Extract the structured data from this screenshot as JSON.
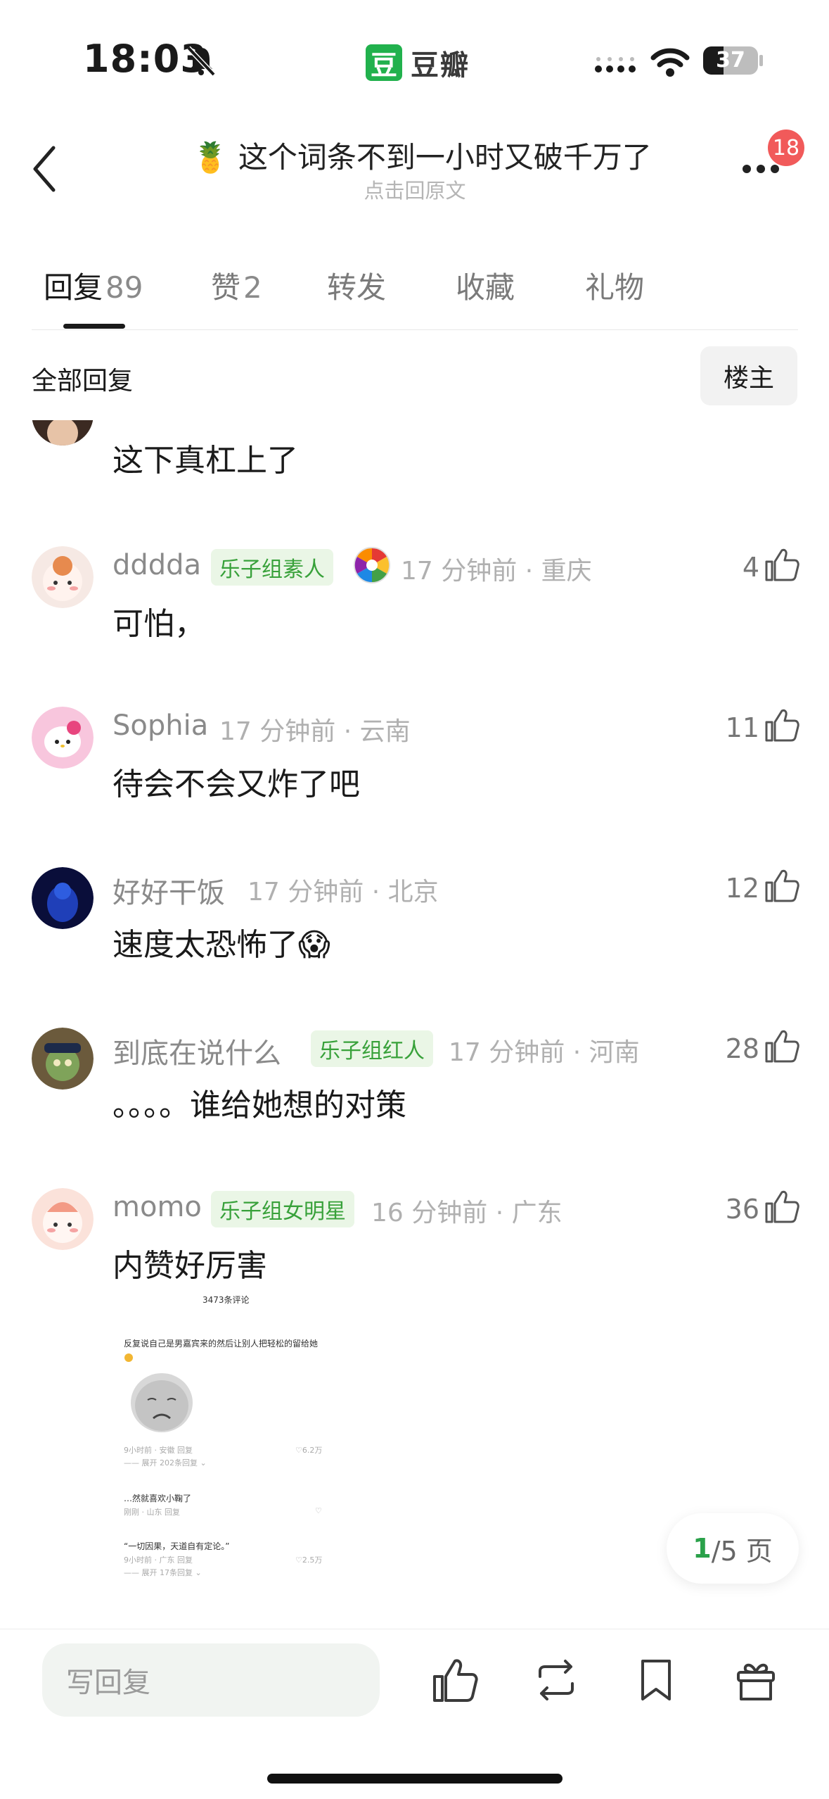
{
  "status_bar": {
    "time": "18:03",
    "battery": "37",
    "battery_level": 0.37
  },
  "app": {
    "logo_char": "豆",
    "name": "豆瓣"
  },
  "header": {
    "title": "🍍 这个词条不到一小时又破千万了",
    "subtitle": "点击回原文",
    "badge_count": "18"
  },
  "tabs": [
    {
      "label": "回复",
      "count": "89"
    },
    {
      "label": "赞",
      "count": "2"
    },
    {
      "label": "转发",
      "count": ""
    },
    {
      "label": "收藏",
      "count": ""
    },
    {
      "label": "礼物",
      "count": ""
    }
  ],
  "filter": {
    "all_label": "全部回复",
    "op_label": "楼主"
  },
  "comments": [
    {
      "text": "这下真杠上了"
    },
    {
      "name": "dddda",
      "tag": "乐子组素人",
      "time": "17 分钟前 · 重庆",
      "text": "可怕，",
      "likes": "4"
    },
    {
      "name": "Sophia",
      "tag": "",
      "time": "17 分钟前 · 云南",
      "text": "待会不会又炸了吧",
      "likes": "11"
    },
    {
      "name": "好好干饭",
      "tag": "",
      "time": "17 分钟前 · 北京",
      "text": "速度太恐怖了😱",
      "likes": "12"
    },
    {
      "name": "到底在说什么",
      "tag": "乐子组红人",
      "time": "17 分钟前 · 河南",
      "text": "。。。。谁给她想的对策",
      "likes": "28"
    },
    {
      "name": "momo",
      "tag": "乐子组女明星",
      "time": "16 分钟前 · 广东",
      "text": "内赞好厉害",
      "likes": "36"
    }
  ],
  "embed": {
    "count": "3473条评论",
    "line1": "反复说自己是男嘉宾来的然后让别人把轻松的留给她",
    "meta1": "9小时前 · 安徽     回复",
    "likes1": "♡6.2万",
    "expand1": "—— 展开 202条回复 ⌄",
    "line2": "…然就喜欢小鞠了",
    "meta2": "刚刚 · 山东    回复",
    "line3": "“一切因果，天道自有定论。”",
    "meta3": "9小时前 · 广东     回复",
    "likes3": "♡2.5万",
    "expand3": "—— 展开 17条回复 ⌄"
  },
  "pager": {
    "current": "1",
    "total": "/5 页"
  },
  "bottom_bar": {
    "placeholder": "写回复"
  }
}
